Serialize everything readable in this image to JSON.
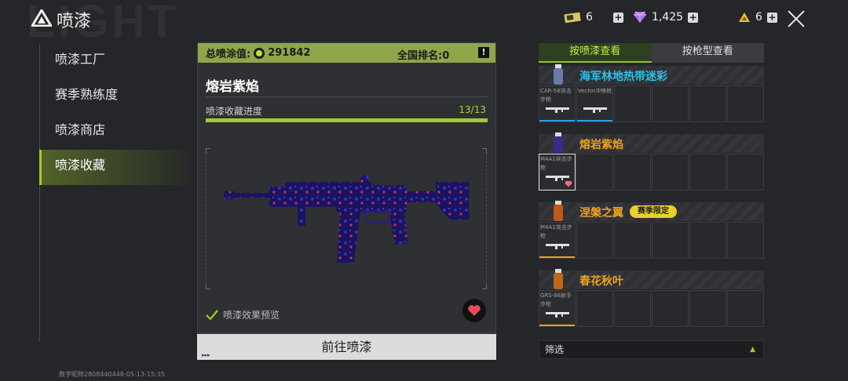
{
  "colors": {
    "accent": "#a6cc2a",
    "orange": "#f0a020",
    "blue": "#2ec0f0"
  },
  "header": {
    "watermark": "LIGHT",
    "title": "喷漆",
    "currency": [
      {
        "icon": "ticket-icon",
        "value": "6"
      },
      {
        "icon": "diamond-icon",
        "value": "1,425"
      },
      {
        "icon": "gold-triangle-icon",
        "value": "6"
      }
    ],
    "plus": "+"
  },
  "sidebar": {
    "items": [
      {
        "label": "喷漆工厂"
      },
      {
        "label": "赛季熟练度"
      },
      {
        "label": "喷漆商店"
      },
      {
        "label": "喷漆收藏",
        "active": true
      }
    ]
  },
  "center": {
    "total_label": "总喷涂值:",
    "total_value": "291842",
    "rank_label": "全国排名:0",
    "info": "!",
    "skin_name": "熔岩紫焰",
    "progress_label": "喷漆收藏进度",
    "progress_count": "13/13",
    "progress_fraction": 1.0,
    "preview_label": "喷漆效果预览",
    "go_button": "前往喷漆",
    "go_dots": "▸▸▸"
  },
  "right": {
    "tabs": [
      {
        "label": "按喷漆查看",
        "active": true
      },
      {
        "label": "按枪型查看"
      }
    ],
    "groups": [
      {
        "name": "海军林地热带迷彩",
        "color": "#2ec0f0",
        "badge": "",
        "weapons": [
          {
            "name": "CAR-58突击步枪",
            "line": "#2e9ee0"
          },
          {
            "name": "Vector冲锋枪",
            "line": "#2e9ee0"
          }
        ]
      },
      {
        "name": "熔岩紫焰",
        "color": "#f0a020",
        "badge": "",
        "weapons": [
          {
            "name": "M4A1突击步枪",
            "selected": true,
            "heart": true
          }
        ]
      },
      {
        "name": "涅槃之翼",
        "color": "#f0a020",
        "badge": "赛季限定",
        "weapons": [
          {
            "name": "M4A1突击步枪",
            "line": "#f0a020"
          }
        ]
      },
      {
        "name": "春花秋叶",
        "color": "#f0a020",
        "badge": "",
        "weapons": [
          {
            "name": "GRS-88射手步枪",
            "line": "#f0a020"
          }
        ]
      }
    ],
    "filter_label": "筛选",
    "filter_arrow": "▲"
  },
  "footer_note": "数字昵称2808440448-05-13-15:35"
}
